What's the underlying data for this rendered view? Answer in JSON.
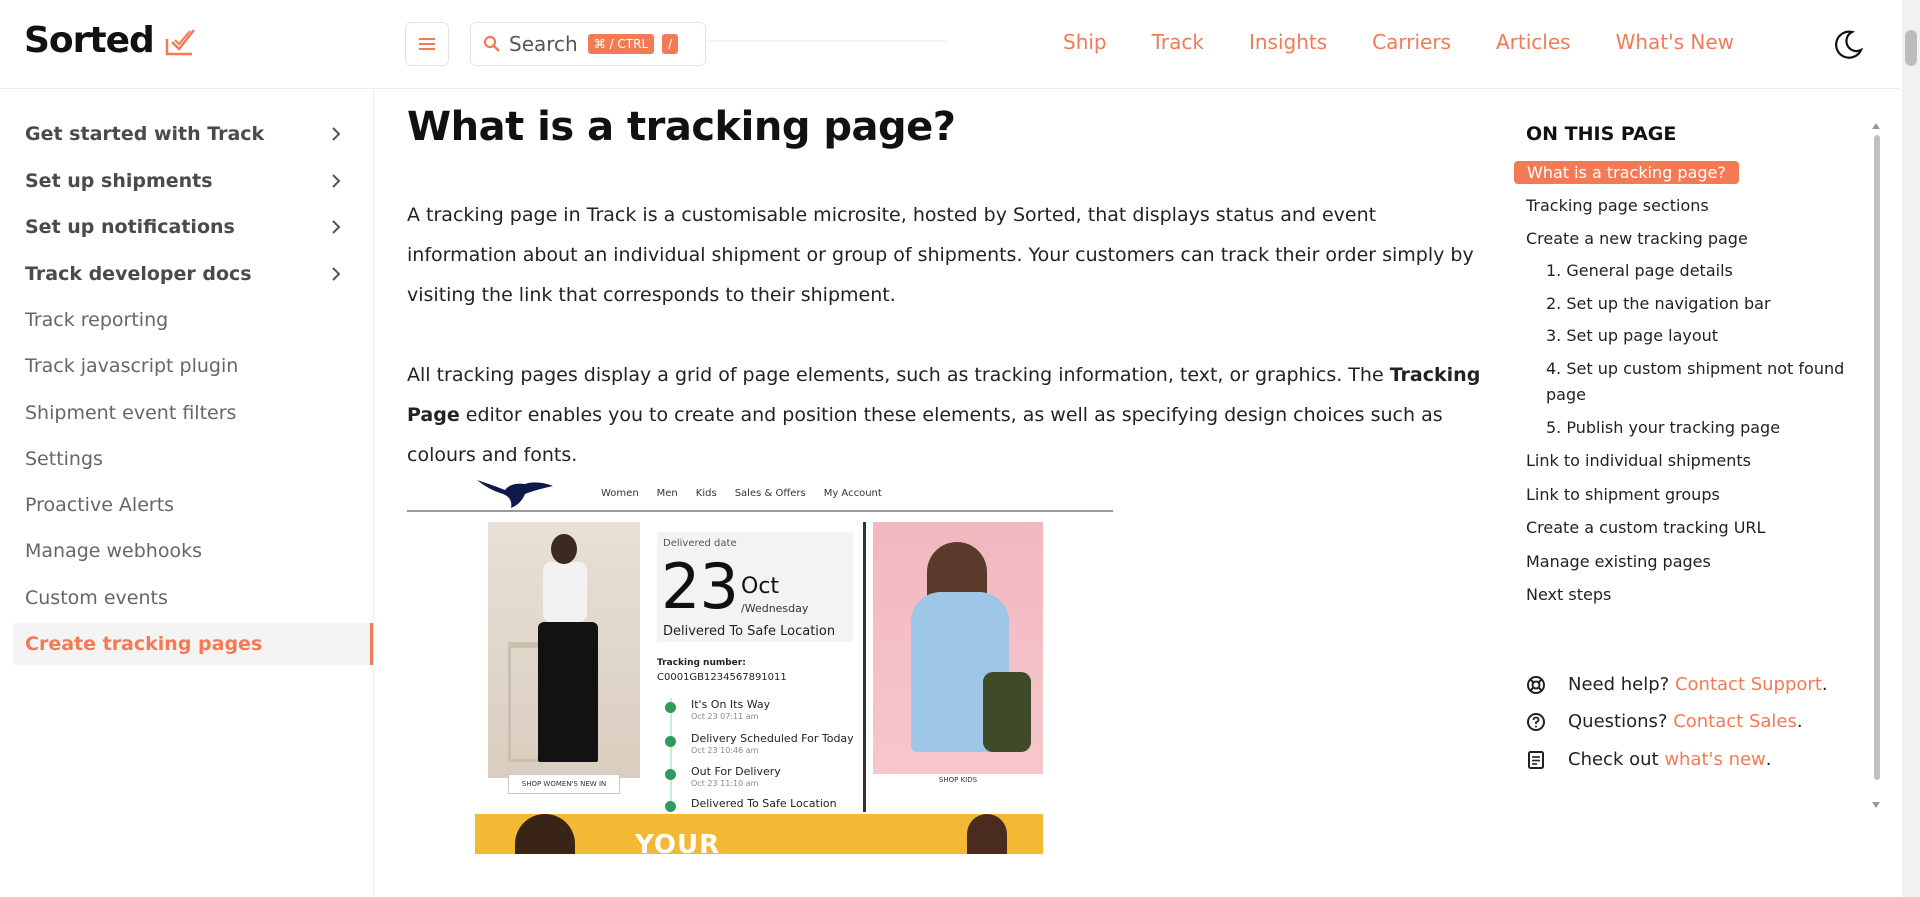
{
  "header": {
    "logo_text": "Sorted",
    "search_label": "Search",
    "search_shortcut": "⌘ / CTRL",
    "search_slash": "/",
    "nav": [
      "Ship",
      "Track",
      "Insights",
      "Carriers",
      "Articles",
      "What's New"
    ]
  },
  "sidebar": {
    "items": [
      {
        "label": "Get started with Track",
        "expandable": true
      },
      {
        "label": "Set up shipments",
        "expandable": true
      },
      {
        "label": "Set up notifications",
        "expandable": true
      },
      {
        "label": "Track developer docs",
        "expandable": true
      },
      {
        "label": "Track reporting",
        "expandable": false
      },
      {
        "label": "Track javascript plugin",
        "expandable": false
      },
      {
        "label": "Shipment event filters",
        "expandable": false
      },
      {
        "label": "Settings",
        "expandable": false
      },
      {
        "label": "Proactive Alerts",
        "expandable": false
      },
      {
        "label": "Manage webhooks",
        "expandable": false
      },
      {
        "label": "Custom events",
        "expandable": false
      },
      {
        "label": "Create tracking pages",
        "expandable": false,
        "active": true
      }
    ]
  },
  "main": {
    "title": "What is a tracking page?",
    "para1": "A tracking page in Track is a customisable microsite, hosted by Sorted, that displays status and event information about an individual shipment or group of shipments. Your customers can track their order simply by visiting the link that corresponds to their shipment.",
    "para2_before": "All tracking pages display a grid of page elements, such as tracking information, text, or graphics. The ",
    "para2_bold": "Tracking Page",
    "para2_after": " editor enables you to create and position these elements, as well as specifying design choices such as colours and fonts."
  },
  "mock": {
    "nav_links": [
      "Women",
      "Men",
      "Kids",
      "Sales & Offers",
      "My Account"
    ],
    "shop_women": "SHOP WOMEN'S NEW IN",
    "delivered_label": "Delivered date",
    "day_num": "23",
    "month": "Oct",
    "weekday": "/Wednesday",
    "delivered_status": "Delivered To Safe Location",
    "tracking_label": "Tracking number:",
    "tracking_value": "C0001GB1234567891011",
    "events": [
      {
        "title": "It's On Its Way",
        "time": "Oct 23 07:11 am"
      },
      {
        "title": "Delivery Scheduled For Today",
        "time": "Oct 23 10:46 am"
      },
      {
        "title": "Out For Delivery",
        "time": "Oct 23 11:10 am"
      },
      {
        "title": "Delivered To Safe Location",
        "time": ""
      }
    ],
    "shop_kids": "SHOP KIDS",
    "banner_text": "YOUR"
  },
  "toc": {
    "title": "ON THIS PAGE",
    "items": [
      {
        "label": "What is a tracking page?",
        "active": true,
        "sub": false
      },
      {
        "label": "Tracking page sections",
        "sub": false
      },
      {
        "label": "Create a new tracking page",
        "sub": false
      },
      {
        "label": "1. General page details",
        "sub": true
      },
      {
        "label": "2. Set up the navigation bar",
        "sub": true
      },
      {
        "label": "3. Set up page layout",
        "sub": true
      },
      {
        "label": "4. Set up custom shipment not found",
        "sub": true
      },
      {
        "label": "page",
        "sub": true
      },
      {
        "label": "5. Publish your tracking page",
        "sub": true
      },
      {
        "label": "Link to individual shipments",
        "sub": false
      },
      {
        "label": "Link to shipment groups",
        "sub": false
      },
      {
        "label": "Create a custom tracking URL",
        "sub": false
      },
      {
        "label": "Manage existing pages",
        "sub": false
      },
      {
        "label": "Next steps",
        "sub": false
      }
    ],
    "help": [
      {
        "prefix": "Need help? ",
        "link": "Contact Support",
        "suffix": "."
      },
      {
        "prefix": "Questions? ",
        "link": "Contact Sales",
        "suffix": "."
      },
      {
        "prefix": "Check out ",
        "link": "what's new",
        "suffix": "."
      }
    ]
  },
  "colors": {
    "accent": "#f47a56",
    "active_bg": "#f4f4f4"
  }
}
